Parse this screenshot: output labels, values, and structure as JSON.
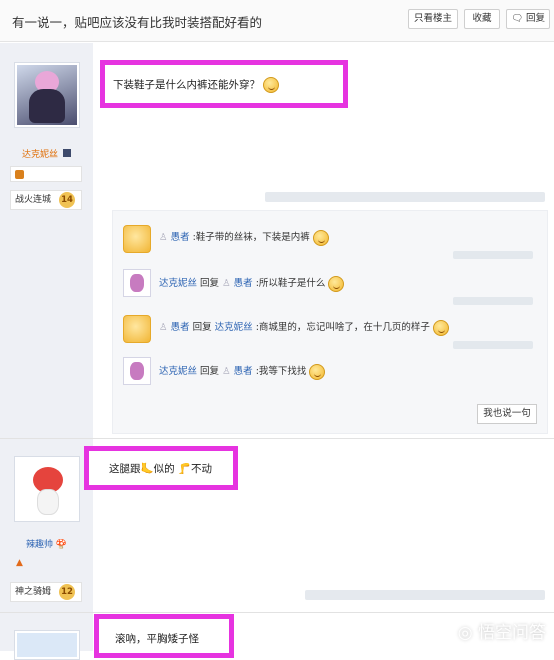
{
  "header": {
    "title": "有一说一，贴吧应该没有比我时装搭配好看的",
    "btn_only_op": "只看楼主",
    "btn_fav": "收藏",
    "btn_reply": "回复"
  },
  "posts": [
    {
      "user": "达克妮丝",
      "level_name": "战火连城",
      "level": "14",
      "content": "下装鞋子是什么内裤还能外穿？"
    },
    {
      "user": "辣趣帅",
      "level_name": "神之骑姆",
      "level": "12",
      "content": "这腿跟🦶似的 🦵不动"
    },
    {
      "content": "滚吶，平胸矮子怪"
    }
  ],
  "replies": [
    {
      "name": "愚者",
      "text": ":鞋子带的丝袜，下装是内裤"
    },
    {
      "name": "达克妮丝",
      "reply_label": "回复",
      "target": "愚者",
      "text": ":所以鞋子是什么"
    },
    {
      "name": "愚者",
      "reply_label": "回复",
      "target": "达克妮丝",
      "text": ":商城里的，忘记叫啥了，在十几页的样子"
    },
    {
      "name": "达克妮丝",
      "reply_label": "回复",
      "target": "愚者",
      "text": ":我等下找找"
    }
  ],
  "say_button": "我也说一句",
  "watermark": "悟空问答",
  "colors": {
    "highlight": "#e633e0",
    "link": "#2d64b3",
    "username": "#e0700a"
  }
}
